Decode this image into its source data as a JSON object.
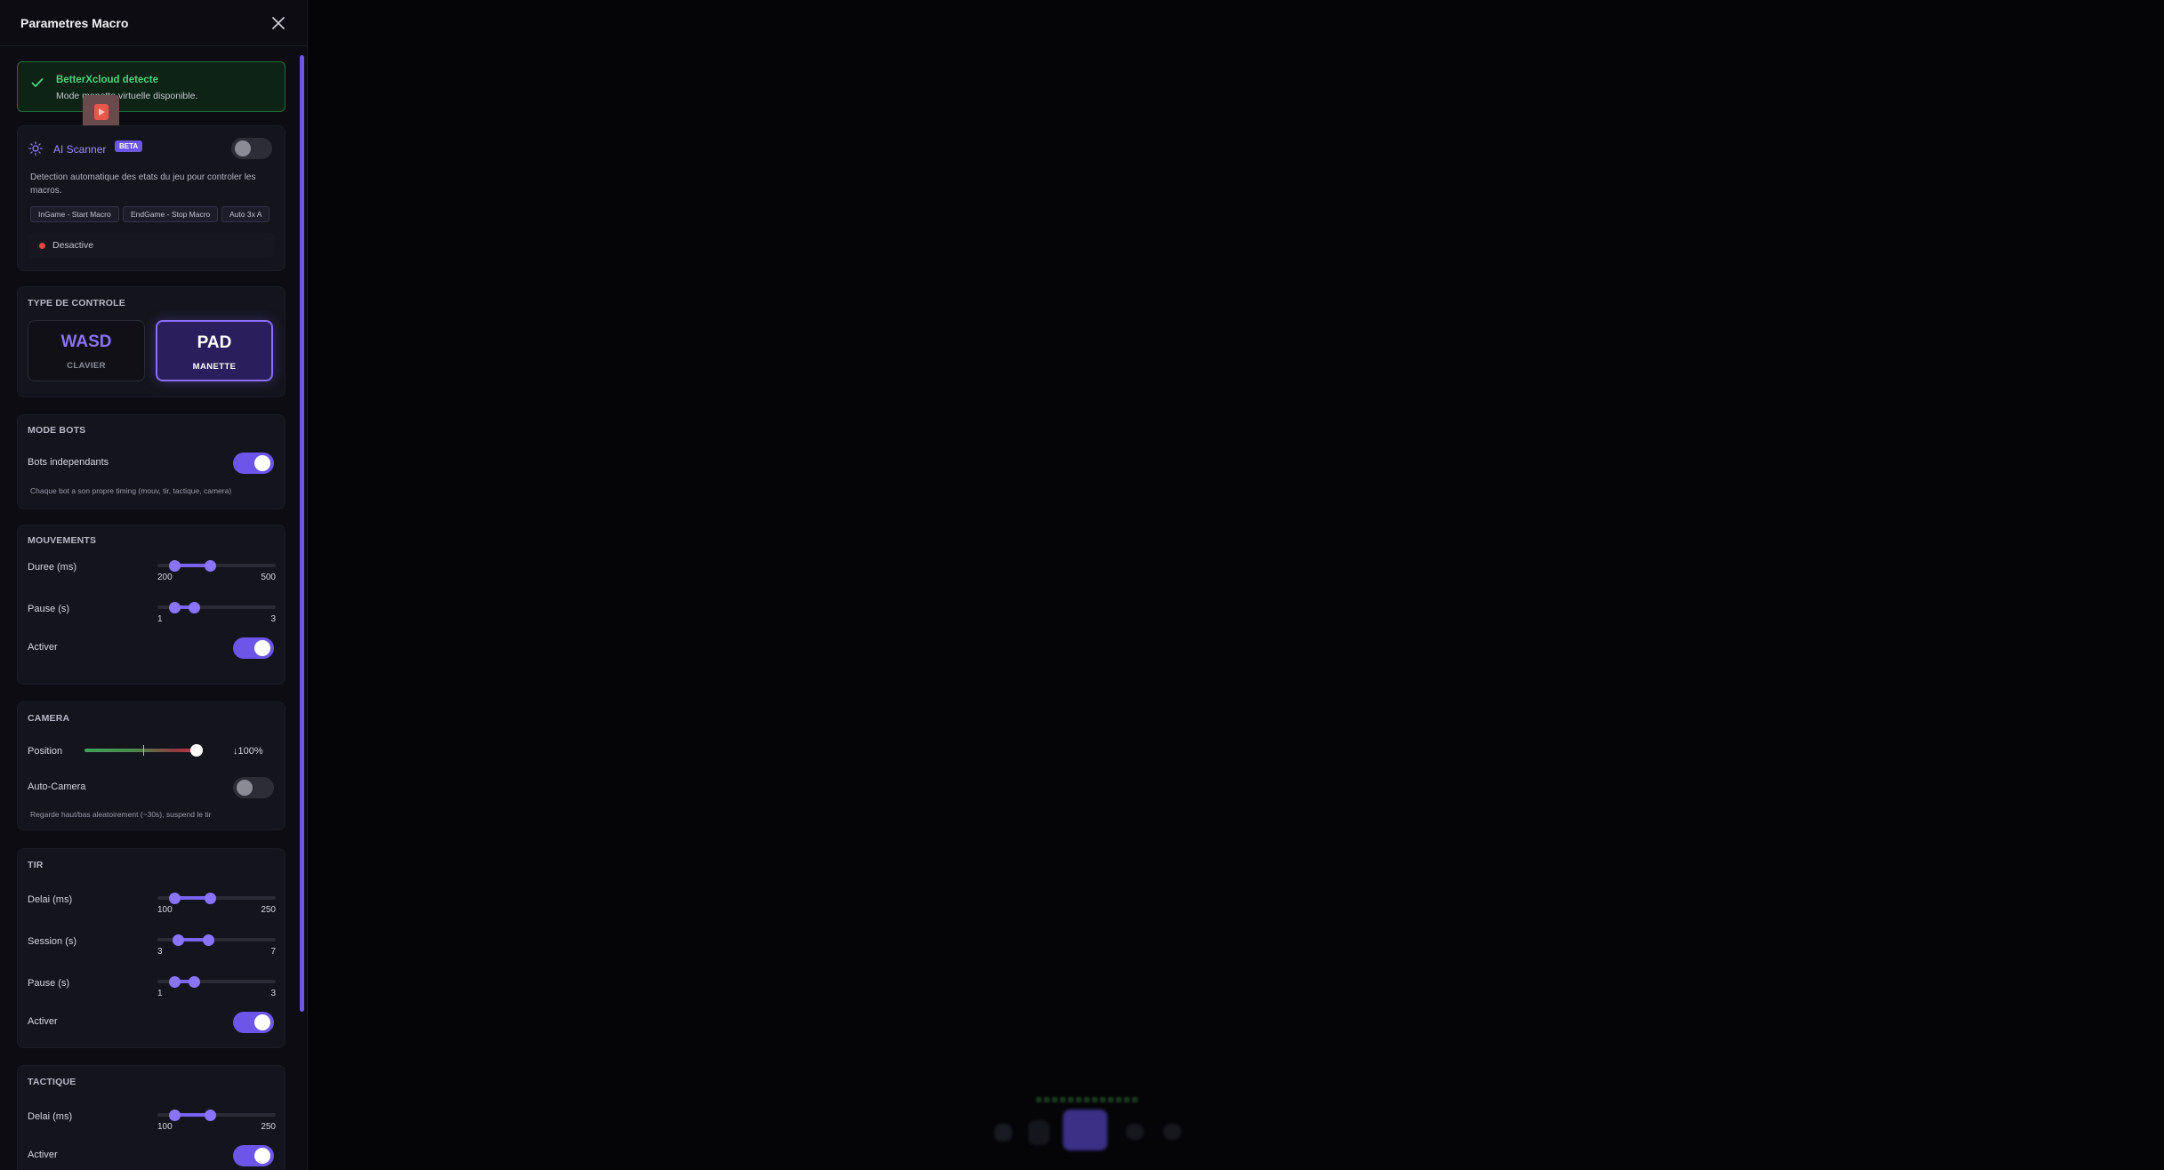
{
  "panel": {
    "title": "Parametres Macro"
  },
  "banner": {
    "title": "BetterXcloud detecte",
    "text": "Mode manette virtuelle disponible."
  },
  "ai_scanner": {
    "title": "AI Scanner",
    "badge": "BETA",
    "enabled": false,
    "description": "Detection automatique des etats du jeu pour controler les macros.",
    "tags": [
      "InGame - Start Macro",
      "EndGame - Stop Macro",
      "Auto 3x A"
    ],
    "status": "Desactive",
    "status_color": "#e04545"
  },
  "control_type": {
    "label": "TYPE DE CONTROLE",
    "options": [
      {
        "big": "WASD",
        "small": "CLAVIER",
        "selected": false
      },
      {
        "big": "PAD",
        "small": "MANETTE",
        "selected": true
      }
    ]
  },
  "bots": {
    "label": "MODE BOTS",
    "row": "Bots independants",
    "enabled": true,
    "hint": "Chaque bot a son propre timing (mouv, tir, tactique, camera)"
  },
  "movements": {
    "label": "MOUVEMENTS",
    "duration": {
      "label": "Duree (ms)",
      "min_label": "200",
      "max_label": "500",
      "low": 0.14,
      "high": 0.44
    },
    "pause": {
      "label": "Pause (s)",
      "min_label": "1",
      "max_label": "3",
      "low": 0.14,
      "high": 0.31
    },
    "activate": {
      "label": "Activer",
      "enabled": true
    }
  },
  "camera": {
    "label": "CAMERA",
    "position": {
      "label": "Position",
      "value_text": "↓100%",
      "value": 1.0
    },
    "auto": {
      "label": "Auto-Camera",
      "enabled": false
    },
    "hint": "Regarde haut/bas aleatoirement (~30s), suspend le tir"
  },
  "tir": {
    "label": "TIR",
    "delay": {
      "label": "Delai (ms)",
      "min_label": "100",
      "max_label": "250",
      "low": 0.14,
      "high": 0.44
    },
    "session": {
      "label": "Session (s)",
      "min_label": "3",
      "max_label": "7",
      "low": 0.17,
      "high": 0.43
    },
    "pause": {
      "label": "Pause (s)",
      "min_label": "1",
      "max_label": "3",
      "low": 0.14,
      "high": 0.31
    },
    "activate": {
      "label": "Activer",
      "enabled": true
    }
  },
  "tactique": {
    "label": "TACTIQUE",
    "delay": {
      "label": "Delai (ms)",
      "min_label": "100",
      "max_label": "250",
      "low": 0.14,
      "high": 0.44
    },
    "activate": {
      "label": "Activer",
      "enabled": true
    }
  },
  "colors": {
    "accent": "#6c55e8",
    "success": "#4fd27a"
  },
  "icons": {
    "close": "close-icon",
    "check": "check-icon",
    "scanner": "sun-icon"
  }
}
